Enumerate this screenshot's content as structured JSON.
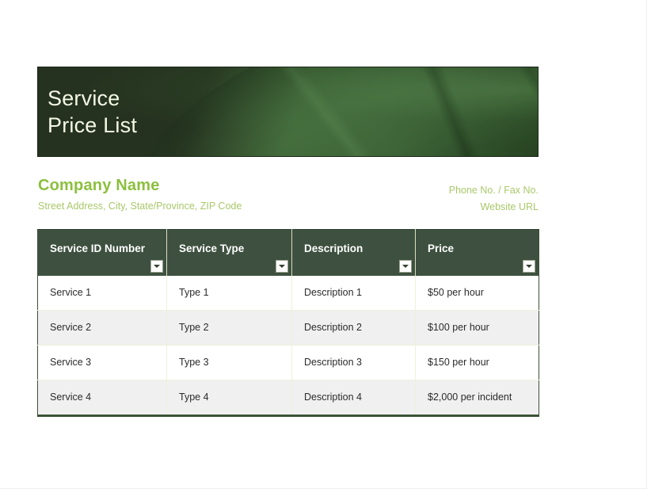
{
  "document": {
    "banner_title": "Service\nPrice List"
  },
  "company": {
    "name": "Company Name",
    "address": "Street Address, City, State/Province, ZIP Code",
    "phone_fax": "Phone No. / Fax No.",
    "website": "Website URL"
  },
  "table": {
    "columns": [
      {
        "label": "Service ID Number"
      },
      {
        "label": "Service Type"
      },
      {
        "label": "Description"
      },
      {
        "label": "Price"
      }
    ],
    "rows": [
      {
        "service_id": "Service 1",
        "service_type": "Type 1",
        "description": "Description 1",
        "price": "$50 per hour"
      },
      {
        "service_id": "Service 2",
        "service_type": "Type 2",
        "description": "Description 2",
        "price": "$100 per hour"
      },
      {
        "service_id": "Service 3",
        "service_type": "Type 3",
        "description": "Description 3",
        "price": "$150 per hour"
      },
      {
        "service_id": "Service 4",
        "service_type": "Type 4",
        "description": "Description 4",
        "price": "$2,000 per incident"
      }
    ]
  },
  "icons": {
    "filter_dropdown": "filter-dropdown-icon"
  },
  "colors": {
    "banner_dark_green": "#25321f",
    "leaf_green": "#3b6133",
    "header_row_green": "#3e5140",
    "company_name_green": "#8cbf3f",
    "company_text_green": "#a9c86a",
    "alt_row_gray": "#f0f0f0",
    "grid_line": "#eef0dc"
  }
}
